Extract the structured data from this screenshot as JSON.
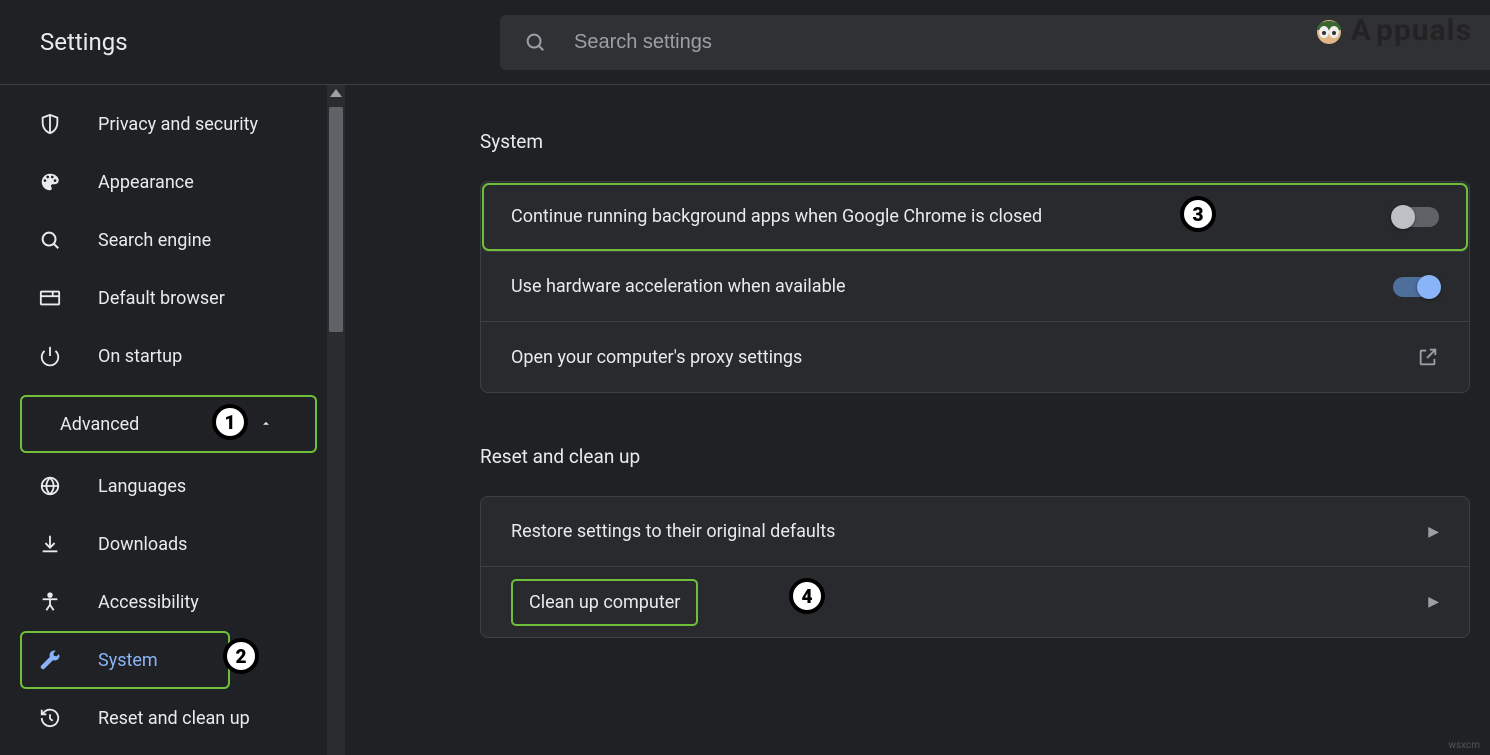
{
  "header": {
    "title": "Settings",
    "search_placeholder": "Search settings"
  },
  "sidebar": {
    "items": [
      {
        "label": "Privacy and security"
      },
      {
        "label": "Appearance"
      },
      {
        "label": "Search engine"
      },
      {
        "label": "Default browser"
      },
      {
        "label": "On startup"
      }
    ],
    "advanced_label": "Advanced",
    "advanced_items": [
      {
        "label": "Languages"
      },
      {
        "label": "Downloads"
      },
      {
        "label": "Accessibility"
      },
      {
        "label": "System"
      },
      {
        "label": "Reset and clean up"
      }
    ]
  },
  "sections": {
    "system_title": "System",
    "reset_title": "Reset and clean up"
  },
  "system_rows": {
    "bg_apps": "Continue running background apps when Google Chrome is closed",
    "hw_accel": "Use hardware acceleration when available",
    "proxy": "Open your computer's proxy settings"
  },
  "reset_rows": {
    "restore": "Restore settings to their original defaults",
    "cleanup": "Clean up computer"
  },
  "callouts": {
    "c1": "1",
    "c2": "2",
    "c3": "3",
    "c4": "4"
  },
  "watermark": {
    "text_a": "A",
    "text_rest": "ppuals"
  },
  "credit": "wsxcm"
}
